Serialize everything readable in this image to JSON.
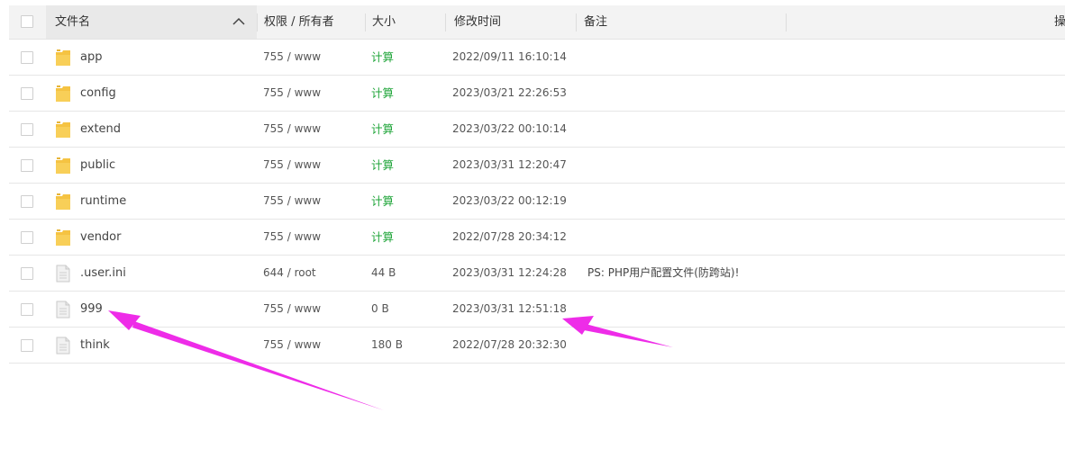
{
  "columns": {
    "name": "文件名",
    "permission": "权限 / 所有者",
    "size": "大小",
    "modified": "修改时间",
    "remark": "备注",
    "action": "操"
  },
  "colors": {
    "accent_green": "#20a53a",
    "annotation_arrow": "#ee2ce8",
    "folder": "#f5c342"
  },
  "rows": [
    {
      "type": "folder",
      "icon": "folder-icon",
      "name": "app",
      "perm": "755 / www",
      "size": "计算",
      "time": "2022/09/11 16:10:14",
      "remark": ""
    },
    {
      "type": "folder",
      "icon": "folder-icon",
      "name": "config",
      "perm": "755 / www",
      "size": "计算",
      "time": "2023/03/21 22:26:53",
      "remark": ""
    },
    {
      "type": "folder",
      "icon": "folder-icon",
      "name": "extend",
      "perm": "755 / www",
      "size": "计算",
      "time": "2023/03/22 00:10:14",
      "remark": ""
    },
    {
      "type": "folder",
      "icon": "folder-icon",
      "name": "public",
      "perm": "755 / www",
      "size": "计算",
      "time": "2023/03/31 12:20:47",
      "remark": ""
    },
    {
      "type": "folder",
      "icon": "folder-icon",
      "name": "runtime",
      "perm": "755 / www",
      "size": "计算",
      "time": "2023/03/22 00:12:19",
      "remark": ""
    },
    {
      "type": "folder",
      "icon": "folder-icon",
      "name": "vendor",
      "perm": "755 / www",
      "size": "计算",
      "time": "2022/07/28 20:34:12",
      "remark": ""
    },
    {
      "type": "file",
      "icon": "file-icon",
      "name": ".user.ini",
      "perm": "644 / root",
      "size": "44 B",
      "time": "2023/03/31 12:24:28",
      "remark": "PS: PHP用户配置文件(防跨站)!"
    },
    {
      "type": "file",
      "icon": "file-icon",
      "name": "999",
      "perm": "755 / www",
      "size": "0 B",
      "time": "2023/03/31 12:51:18",
      "remark": ""
    },
    {
      "type": "file",
      "icon": "file-icon",
      "name": "think",
      "perm": "755 / www",
      "size": "180 B",
      "time": "2022/07/28 20:32:30",
      "remark": ""
    }
  ]
}
